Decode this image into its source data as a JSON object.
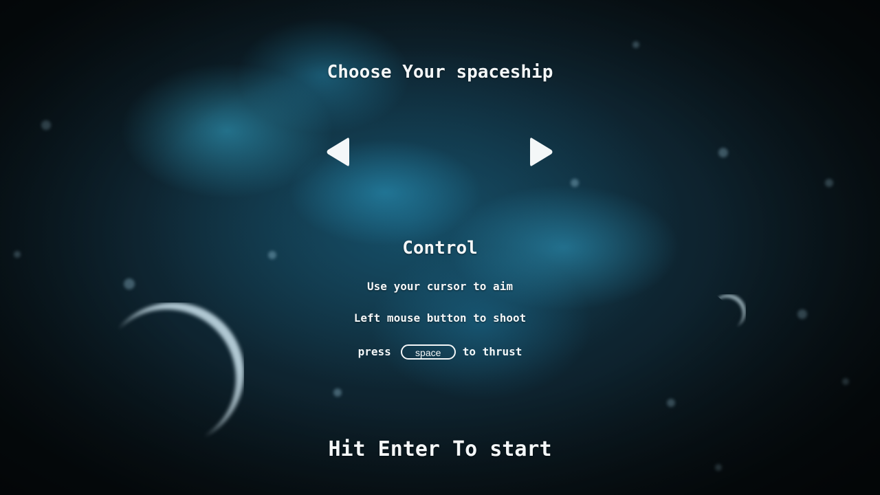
{
  "screen": {
    "title": "Choose Your spaceship",
    "control_heading": "Control",
    "controls": {
      "aim": "Use your cursor to aim",
      "shoot": "Left mouse button to shoot",
      "thrust_prefix": "press",
      "thrust_key": "space",
      "thrust_suffix": "to thrust"
    },
    "start_prompt": "Hit Enter To start"
  },
  "icons": {
    "prev": "arrow-left-icon",
    "next": "arrow-right-icon"
  },
  "colors": {
    "text": "#f4f7f8",
    "nebula": "#2fa8cc",
    "background": "#0a161c"
  }
}
